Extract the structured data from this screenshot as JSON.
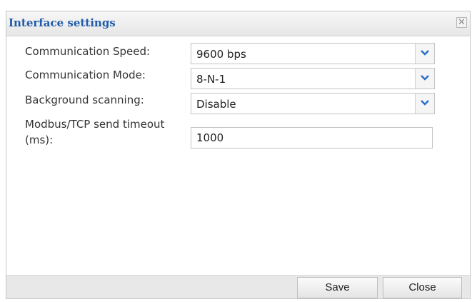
{
  "dialog": {
    "title": "Interface settings",
    "close_glyph": "✕",
    "close_icon": "close-icon"
  },
  "fields": {
    "speed": {
      "label": "Communication Speed:",
      "value": "9600 bps",
      "icon": "chevron-down-icon"
    },
    "mode": {
      "label": "Communication Mode:",
      "value": "8-N-1",
      "icon": "chevron-down-icon"
    },
    "scanning": {
      "label": "Background scanning:",
      "value": "Disable",
      "icon": "chevron-down-icon"
    },
    "timeout": {
      "label_line1": "Modbus/TCP send timeout",
      "label_line2": "(ms):",
      "value": "1000"
    }
  },
  "buttons": {
    "save": "Save",
    "close": "Close"
  },
  "colors": {
    "title": "#1f5ba8",
    "chevron": "#2a6fc9"
  }
}
